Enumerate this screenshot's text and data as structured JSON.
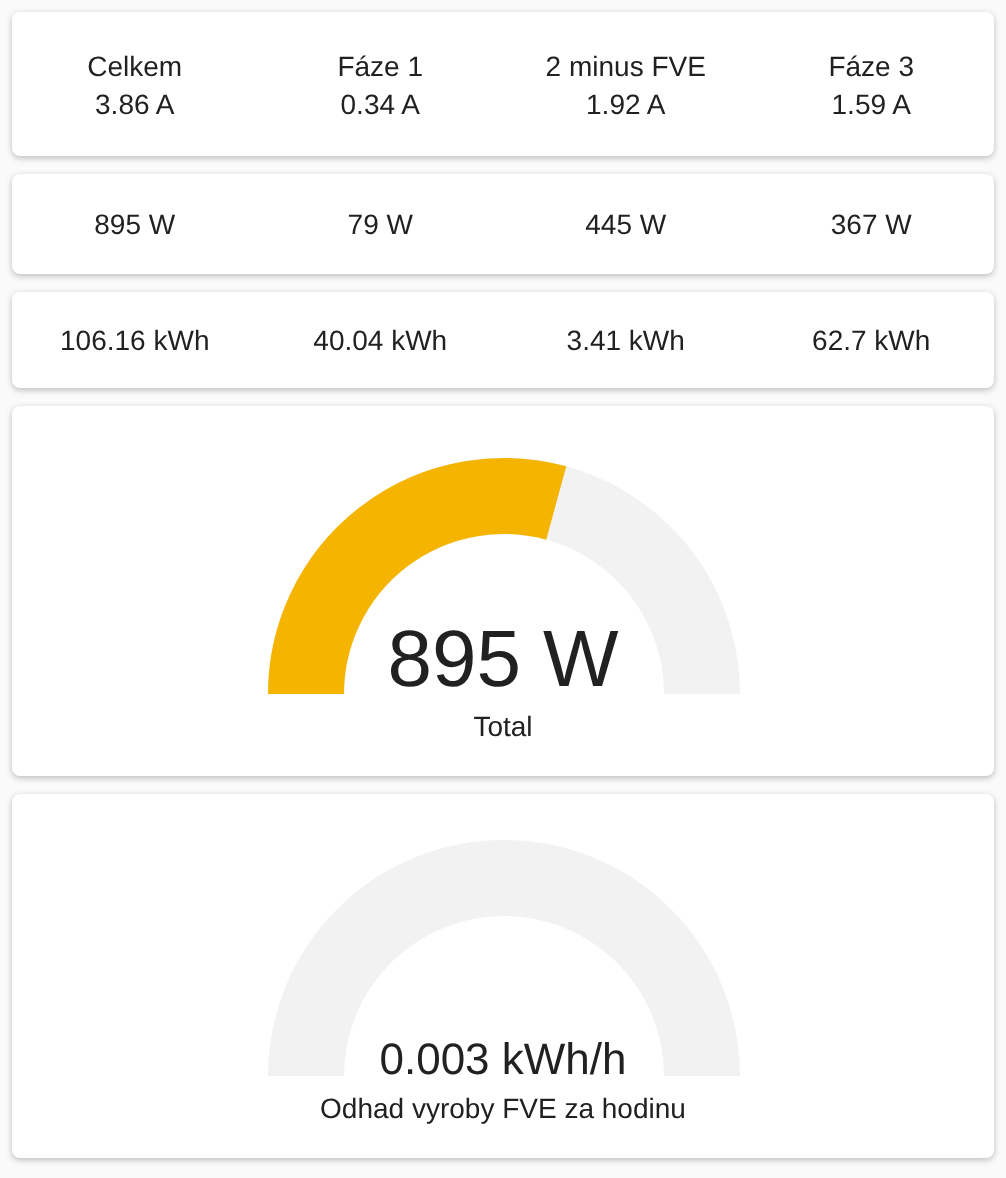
{
  "current": [
    {
      "label": "Celkem",
      "value": "3.86 A"
    },
    {
      "label": "Fáze 1",
      "value": "0.34 A"
    },
    {
      "label": "2 minus FVE",
      "value": "1.92 A"
    },
    {
      "label": "Fáze 3",
      "value": "1.59 A"
    }
  ],
  "power": [
    "895 W",
    "79 W",
    "445 W",
    "367 W"
  ],
  "energy": [
    "106.16 kWh",
    "40.04 kWh",
    "3.41 kWh",
    "62.7 kWh"
  ],
  "gauges": [
    {
      "value": "895 W",
      "label": "Total",
      "level": 0.585
    },
    {
      "value": "0.003 kWh/h",
      "label": "Odhad vyroby FVE za hodinu"
    }
  ]
}
